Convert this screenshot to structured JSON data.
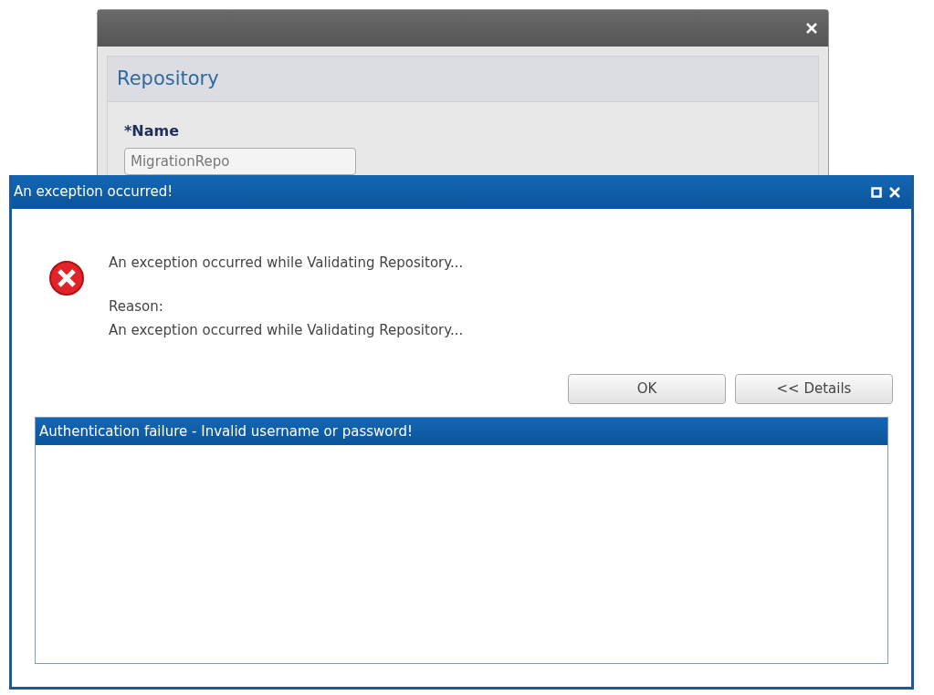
{
  "background_window": {
    "title": "Repository",
    "field": {
      "label": "*Name",
      "value": "MigrationRepo"
    }
  },
  "dialog": {
    "title": "An exception occurred!",
    "message": "An exception occurred while Validating Repository...",
    "reason_label": "Reason:",
    "reason": "An exception occurred while Validating Repository...",
    "buttons": [
      {
        "label": "OK"
      },
      {
        "label": "<< Details"
      }
    ],
    "details": [
      {
        "text": "Authentication failure - Invalid username or password!",
        "selected": true
      }
    ]
  }
}
